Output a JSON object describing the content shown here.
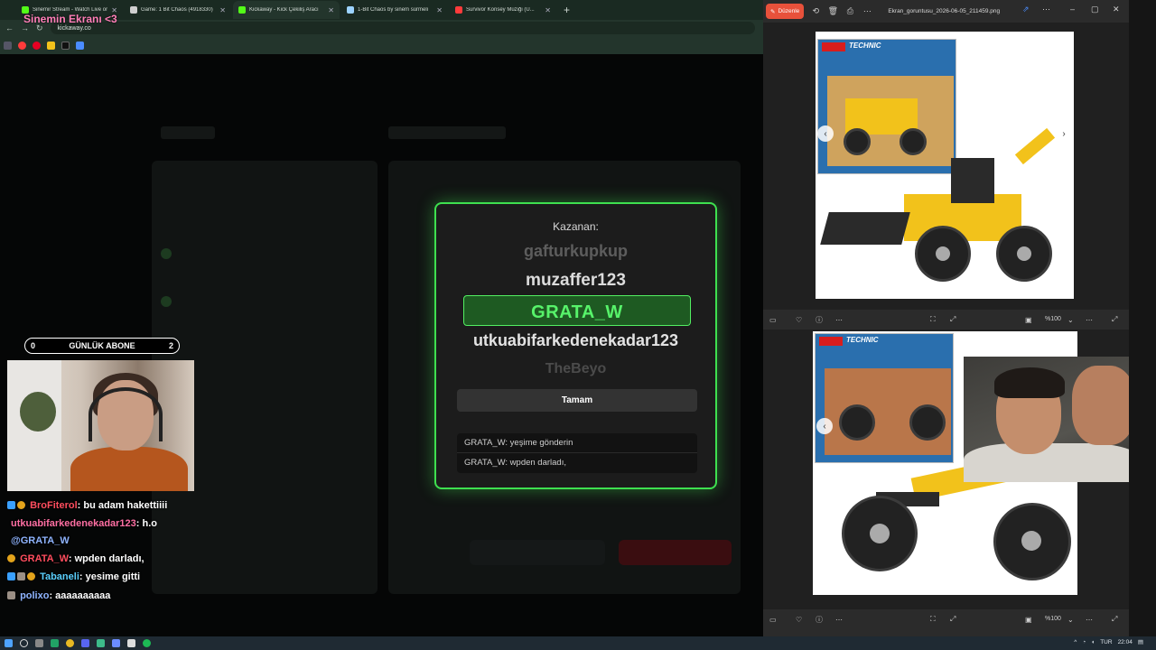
{
  "browser": {
    "tabs": [
      {
        "title": "Sinemir Stream - Watch Live or",
        "color": "#53fc18",
        "active": false
      },
      {
        "title": "Game: 1 Bit Chaos (4918330)",
        "color": "#cfcfcf",
        "active": false
      },
      {
        "title": "Kickaway - Kick Çekiliş Aracı",
        "color": "#53fc18",
        "active": true
      },
      {
        "title": "1-Bit Chaos by sinem sürmeli",
        "color": "#9cd3ff",
        "active": false
      },
      {
        "title": "Survivor Konsey Müziği (U...",
        "color": "#ff3b3b",
        "active": false
      }
    ],
    "url": "kickaway.co",
    "overlay_title": "Sinemin Ekranı <3"
  },
  "modal": {
    "winner_label": "Kazanan:",
    "names_above": [
      "gafturkupkup",
      "muzaffer123"
    ],
    "winner": "GRATA_W",
    "names_below": [
      "utkuabifarkedenekadar123",
      "TheBeyo"
    ],
    "ok_label": "Tamam",
    "messages": [
      "GRATA_W: yeşime gönderin",
      "GRATA_W: wpden darladı,"
    ]
  },
  "stream": {
    "sub_bar": {
      "left": "0",
      "label": "GÜNLÜK ABONE",
      "right": "2"
    },
    "chat": [
      {
        "user": "BroFiterol",
        "user_color": "#ff4d5e",
        "text": ": bu adam hakettiiii",
        "badges": [
          "blue",
          "gold"
        ]
      },
      {
        "user": "utkuabifarkedenekadar123",
        "user_color": "#ff6fa3",
        "text": ": h.o",
        "badges": []
      },
      {
        "user": "@GRATA_W",
        "user_color": "#8fb4ff",
        "text": "",
        "badges": []
      },
      {
        "user": "GRATA_W",
        "user_color": "#ff4d5e",
        "text": ": wpden darladı,",
        "badges": [
          "gold"
        ]
      },
      {
        "user": "Tabaneli",
        "user_color": "#5ad0ff",
        "text": ": yesime gitti",
        "badges": [
          "blue",
          "grey",
          "gold"
        ]
      },
      {
        "user": "polixo",
        "user_color": "#8fb4ff",
        "text": ": aaaaaaaaaa",
        "badges": [
          "grey"
        ]
      }
    ]
  },
  "viewer": {
    "edit_label": "Düzenle",
    "file_name": "Ekran_goruntusu_2026-06-05_211459.png",
    "zoom_top": "%100",
    "zoom_bottom": "%100",
    "brand_text": "TECHNIC"
  },
  "taskbar": {
    "lang": "TUR",
    "time": "22:04"
  }
}
